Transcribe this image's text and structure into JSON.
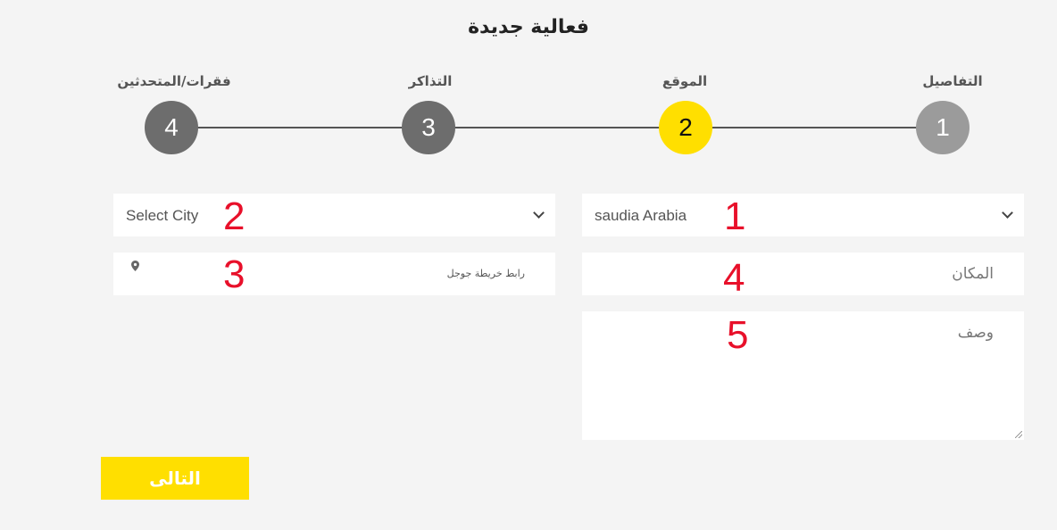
{
  "page_title": "فعالية جديدة",
  "steps": [
    {
      "number": "1",
      "label": "التفاصيل",
      "color": "#9b9b9b",
      "state": "done"
    },
    {
      "number": "2",
      "label": "الموقع",
      "color": "#ffdf00",
      "state": "active"
    },
    {
      "number": "3",
      "label": "التذاكر",
      "color": "#6d6d6d",
      "state": "upcoming"
    },
    {
      "number": "4",
      "label": "فقرات/المتحدثين",
      "color": "#6d6d6d",
      "state": "upcoming"
    }
  ],
  "form": {
    "country_select": {
      "value": "saudia Arabia",
      "annotation": "1"
    },
    "city_select": {
      "value": "Select City",
      "annotation": "2"
    },
    "map_link": {
      "placeholder": "رابط خريطة جوجل",
      "annotation": "3"
    },
    "venue": {
      "placeholder": "المكان",
      "annotation": "4"
    },
    "description": {
      "placeholder": "وصف",
      "annotation": "5"
    }
  },
  "next_button_label": "التالى",
  "colors": {
    "accent": "#ffdf00",
    "annotation": "#e8102a",
    "background": "#f4f4f4"
  }
}
